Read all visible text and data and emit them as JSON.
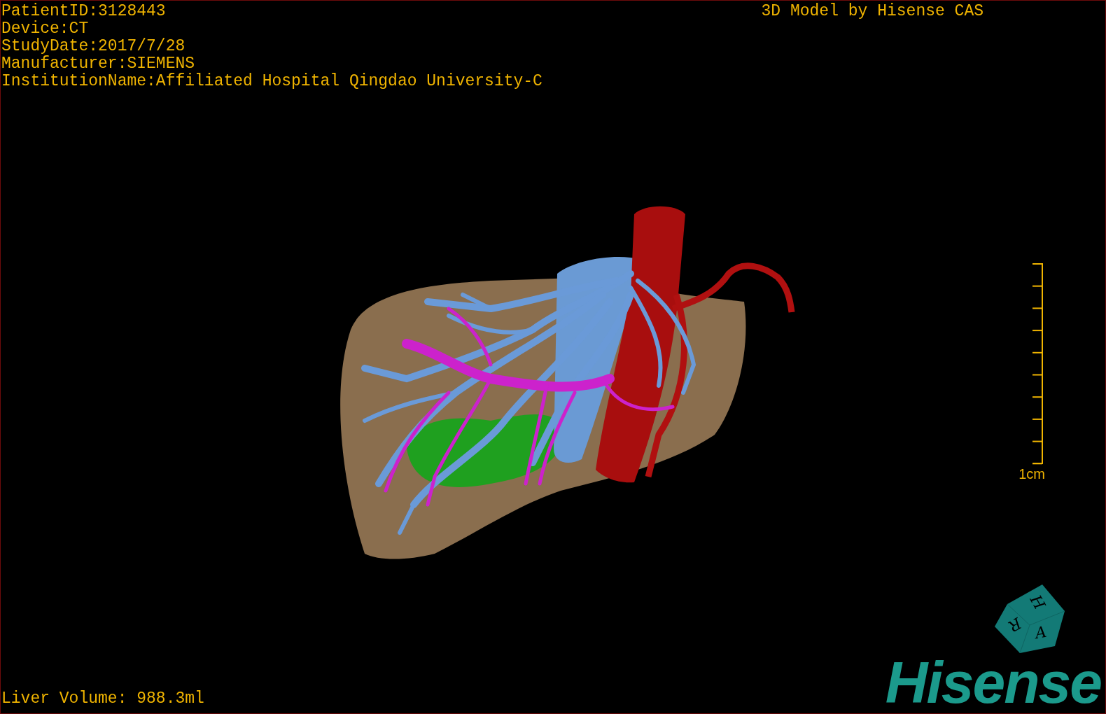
{
  "study_info": [
    "PatientID:3128443",
    "Device:CT",
    "StudyDate:2017/7/28",
    "Manufacturer:SIEMENS",
    "InstitutionName:Affiliated Hospital Qingdao University-C"
  ],
  "title": "3D Model by Hisense CAS",
  "scale_bar": {
    "label": "1cm"
  },
  "orientation_cube": {
    "faces": [
      "H",
      "R",
      "A"
    ]
  },
  "measurement": "Liver Volume: 988.3ml",
  "logo": "Hisense"
}
